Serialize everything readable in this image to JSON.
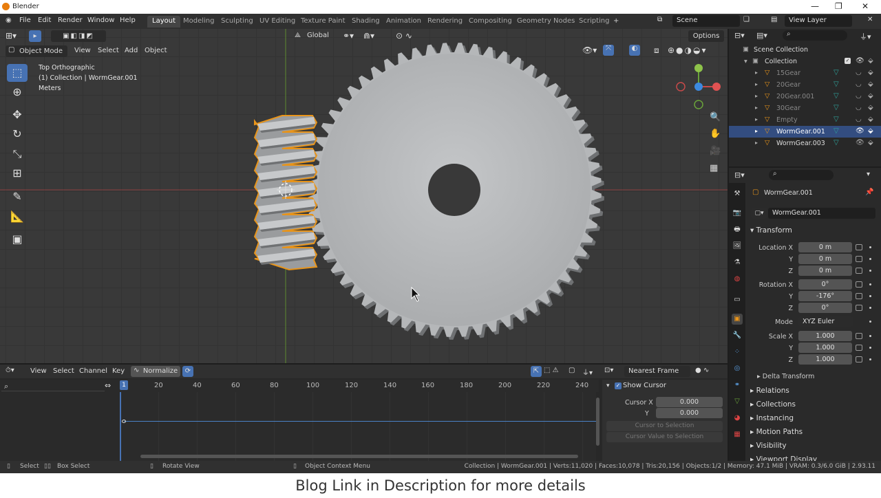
{
  "window": {
    "title": "Blender"
  },
  "menu": {
    "items": [
      "File",
      "Edit",
      "Render",
      "Window",
      "Help"
    ]
  },
  "workspaces": {
    "tabs": [
      "Layout",
      "Modeling",
      "Sculpting",
      "UV Editing",
      "Texture Paint",
      "Shading",
      "Animation",
      "Rendering",
      "Compositing",
      "Geometry Nodes",
      "Scripting"
    ],
    "active": "Layout"
  },
  "scene": {
    "name": "Scene",
    "view_layer": "View Layer"
  },
  "viewport": {
    "mode": "Object Mode",
    "menus": [
      "View",
      "Select",
      "Add",
      "Object"
    ],
    "transform_orientation": "Global",
    "options_label": "Options",
    "overlay": {
      "line1": "Top Orthographic",
      "line2": "(1) Collection | WormGear.001",
      "line3": "Meters"
    }
  },
  "outliner": {
    "root": "Scene Collection",
    "collection": "Collection",
    "items": [
      {
        "name": "15Gear",
        "selected": false
      },
      {
        "name": "20Gear",
        "selected": false
      },
      {
        "name": "20Gear.001",
        "selected": false
      },
      {
        "name": "30Gear",
        "selected": false
      },
      {
        "name": "Empty",
        "selected": false
      },
      {
        "name": "WormGear.001",
        "selected": true
      },
      {
        "name": "WormGear.003",
        "selected": false
      }
    ]
  },
  "properties": {
    "object_name": "WormGear.001",
    "data_name": "WormGear.001",
    "transform_label": "Transform",
    "location": {
      "label": "Location X",
      "x": "0 m",
      "y": "0 m",
      "z": "0 m"
    },
    "rotation": {
      "label": "Rotation X",
      "x": "0°",
      "y": "-176°",
      "z": "0°"
    },
    "mode": {
      "label": "Mode",
      "value": "XYZ Euler"
    },
    "scale": {
      "label": "Scale X",
      "x": "1.000",
      "y": "1.000",
      "z": "1.000"
    },
    "axis_y": "Y",
    "axis_z": "Z",
    "sections": [
      "Delta Transform",
      "Relations",
      "Collections",
      "Instancing",
      "Motion Paths",
      "Visibility",
      "Viewport Display"
    ]
  },
  "timeline": {
    "menus": [
      "View",
      "Select",
      "Channel",
      "Key"
    ],
    "normalize": "Normalize",
    "snap": "Nearest Frame",
    "current_frame": "1",
    "ticks": [
      "20",
      "40",
      "60",
      "80",
      "100",
      "120",
      "140",
      "160",
      "180",
      "200",
      "220",
      "240"
    ],
    "side_panel": {
      "show_cursor": "Show Cursor",
      "cursor_x_label": "Cursor X",
      "cursor_x": "0.000",
      "cursor_y_label": "Y",
      "cursor_y": "0.000",
      "btn1": "Cursor to Selection",
      "btn2": "Cursor Value to Selection"
    }
  },
  "statusbar": {
    "select": "Select",
    "box_select": "Box Select",
    "rotate": "Rotate View",
    "context": "Object Context Menu",
    "stats": "Collection | WormGear.001 | Verts:11,020 | Faces:10,078 | Tris:20,156 | Objects:1/2 | Memory: 47.1 MiB | VRAM: 0.3/6.0 GiB | 2.93.11"
  },
  "caption": "Blog Link in Description for more details",
  "colors": {
    "accent": "#4772b3",
    "selection": "#e8941a",
    "x_axis": "#b34a4a",
    "y_axis": "#6aa33a"
  }
}
